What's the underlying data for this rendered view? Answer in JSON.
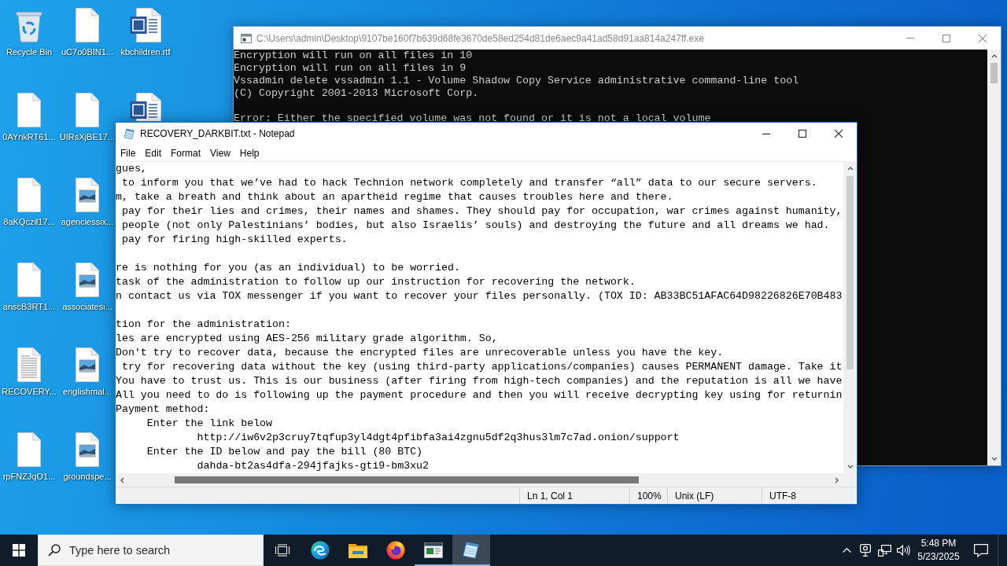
{
  "desktop_icons": [
    {
      "kind": "recycle_bin",
      "label": "Recycle Bin"
    },
    {
      "kind": "blank",
      "label": "0AYnkRT61..."
    },
    {
      "kind": "blank",
      "label": "8aKQczil17..."
    },
    {
      "kind": "blank",
      "label": "anscB3RT1..."
    },
    {
      "kind": "text",
      "label": "RECOVERY..."
    },
    {
      "kind": "blank",
      "label": "rpFNZJqO1..."
    },
    {
      "kind": "blank",
      "label": "uC7o0BIN1..."
    },
    {
      "kind": "blank",
      "label": "UIRsXjBE17..."
    },
    {
      "kind": "image",
      "label": "agenciessix..."
    },
    {
      "kind": "image",
      "label": "associatesi..."
    },
    {
      "kind": "image",
      "label": "englishmal..."
    },
    {
      "kind": "image",
      "label": "groundspe..."
    },
    {
      "kind": "word",
      "label": "kbchildren.rtf"
    },
    {
      "kind": "word"
    }
  ],
  "console_window": {
    "title": "C:\\Users\\admin\\Desktop\\9107be160f7b639d68fe3670de58ed254d81de6aec9a41ad58d91aa814a247ff.exe",
    "active": false,
    "output": [
      [
        "Encryption will run on all files in 10",
        "Encryption will run on all files in 9",
        "Vssadmin delete vssadmin 1.1 - Volume Shadow Copy Service administrative command-line tool",
        "(C) Copyright 2001-2013 Microsoft Corp."
      ],
      [
        "Error: Either the specified volume was not found or it is not a local volume"
      ]
    ]
  },
  "notepad_window": {
    "title": "RECOVERY_DARKBIT.txt - Notepad",
    "active": true,
    "menu": [
      "File",
      "Edit",
      "Format",
      "View",
      "Help"
    ],
    "text": [
      [
        "gues,",
        " to inform you that we’ve had to hack Technion network completely and transfer “all” data to our secure servers.",
        "m, take a breath and think about an apartheid regime that causes troubles here and there.",
        " pay for their lies and crimes, their names and shames. They should pay for occupation, war crimes against humanity,",
        " people (not only Palestinians’ bodies, but also Israelis’ souls) and destroying the future and all dreams we had.",
        " pay for firing high-skilled experts."
      ],
      [
        "re is nothing for you (as an individual) to be worried.",
        "task of the administration to follow up our instruction for recovering the network.",
        "n contact us via TOX messenger if you want to recover your files personally. (TOX ID: AB33BC51AFAC64D98226826E70B483"
      ],
      [
        "tion for the administration:",
        "les are encrypted using AES-256 military grade algorithm. So,",
        "Don't try to recover data, because the encrypted files are unrecoverable unless you have the key.",
        " try for recovering data without the key (using third-party applications/companies) causes PERMANENT damage. Take it",
        "You have to trust us. This is our business (after firing from high-tech companies) and the reputation is all we have",
        "All you need to do is following up the payment procedure and then you will receive decrypting key using for returnin",
        "Payment method:",
        "     Enter the link below",
        "             http://iw6v2p3cruy7tqfup3yl4dgt4pfibfa3ai4zgnu5df2q3hus3lm7c7ad.onion/support",
        "     Enter the ID below and pay the bill (80 BTC)",
        "             dahda-bt2as4dfa-294jfajks-gti9-bm3xu2"
      ]
    ],
    "status_bar": {
      "position": "Ln 1, Col 1",
      "zoom": "100%",
      "line_ending": "Unix (LF)",
      "encoding": "UTF-8"
    }
  },
  "taskbar": {
    "search_placeholder": "Type here to search",
    "apps": [
      {
        "kind": "edge",
        "selected": false,
        "running": false
      },
      {
        "kind": "file_explorer",
        "selected": false,
        "running": false
      },
      {
        "kind": "firefox",
        "selected": false,
        "running": false
      },
      {
        "kind": "console",
        "selected": false,
        "running": true
      },
      {
        "kind": "notepad",
        "selected": true,
        "running": true
      }
    ],
    "clock": {
      "time": "5:48 PM",
      "date": "5/23/2025"
    }
  }
}
